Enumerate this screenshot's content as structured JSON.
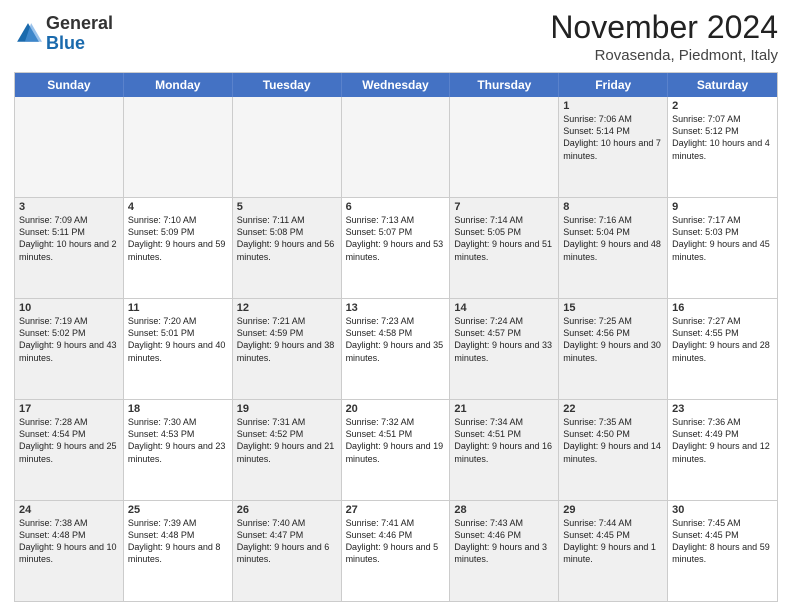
{
  "logo": {
    "general": "General",
    "blue": "Blue"
  },
  "header": {
    "month": "November 2024",
    "location": "Rovasenda, Piedmont, Italy"
  },
  "weekdays": [
    "Sunday",
    "Monday",
    "Tuesday",
    "Wednesday",
    "Thursday",
    "Friday",
    "Saturday"
  ],
  "rows": [
    [
      {
        "day": "",
        "text": "",
        "empty": true
      },
      {
        "day": "",
        "text": "",
        "empty": true
      },
      {
        "day": "",
        "text": "",
        "empty": true
      },
      {
        "day": "",
        "text": "",
        "empty": true
      },
      {
        "day": "",
        "text": "",
        "empty": true
      },
      {
        "day": "1",
        "text": "Sunrise: 7:06 AM\nSunset: 5:14 PM\nDaylight: 10 hours and 7 minutes.",
        "shaded": true
      },
      {
        "day": "2",
        "text": "Sunrise: 7:07 AM\nSunset: 5:12 PM\nDaylight: 10 hours and 4 minutes.",
        "shaded": false
      }
    ],
    [
      {
        "day": "3",
        "text": "Sunrise: 7:09 AM\nSunset: 5:11 PM\nDaylight: 10 hours and 2 minutes.",
        "shaded": true
      },
      {
        "day": "4",
        "text": "Sunrise: 7:10 AM\nSunset: 5:09 PM\nDaylight: 9 hours and 59 minutes.",
        "shaded": false
      },
      {
        "day": "5",
        "text": "Sunrise: 7:11 AM\nSunset: 5:08 PM\nDaylight: 9 hours and 56 minutes.",
        "shaded": true
      },
      {
        "day": "6",
        "text": "Sunrise: 7:13 AM\nSunset: 5:07 PM\nDaylight: 9 hours and 53 minutes.",
        "shaded": false
      },
      {
        "day": "7",
        "text": "Sunrise: 7:14 AM\nSunset: 5:05 PM\nDaylight: 9 hours and 51 minutes.",
        "shaded": true
      },
      {
        "day": "8",
        "text": "Sunrise: 7:16 AM\nSunset: 5:04 PM\nDaylight: 9 hours and 48 minutes.",
        "shaded": true
      },
      {
        "day": "9",
        "text": "Sunrise: 7:17 AM\nSunset: 5:03 PM\nDaylight: 9 hours and 45 minutes.",
        "shaded": false
      }
    ],
    [
      {
        "day": "10",
        "text": "Sunrise: 7:19 AM\nSunset: 5:02 PM\nDaylight: 9 hours and 43 minutes.",
        "shaded": true
      },
      {
        "day": "11",
        "text": "Sunrise: 7:20 AM\nSunset: 5:01 PM\nDaylight: 9 hours and 40 minutes.",
        "shaded": false
      },
      {
        "day": "12",
        "text": "Sunrise: 7:21 AM\nSunset: 4:59 PM\nDaylight: 9 hours and 38 minutes.",
        "shaded": true
      },
      {
        "day": "13",
        "text": "Sunrise: 7:23 AM\nSunset: 4:58 PM\nDaylight: 9 hours and 35 minutes.",
        "shaded": false
      },
      {
        "day": "14",
        "text": "Sunrise: 7:24 AM\nSunset: 4:57 PM\nDaylight: 9 hours and 33 minutes.",
        "shaded": true
      },
      {
        "day": "15",
        "text": "Sunrise: 7:25 AM\nSunset: 4:56 PM\nDaylight: 9 hours and 30 minutes.",
        "shaded": true
      },
      {
        "day": "16",
        "text": "Sunrise: 7:27 AM\nSunset: 4:55 PM\nDaylight: 9 hours and 28 minutes.",
        "shaded": false
      }
    ],
    [
      {
        "day": "17",
        "text": "Sunrise: 7:28 AM\nSunset: 4:54 PM\nDaylight: 9 hours and 25 minutes.",
        "shaded": true
      },
      {
        "day": "18",
        "text": "Sunrise: 7:30 AM\nSunset: 4:53 PM\nDaylight: 9 hours and 23 minutes.",
        "shaded": false
      },
      {
        "day": "19",
        "text": "Sunrise: 7:31 AM\nSunset: 4:52 PM\nDaylight: 9 hours and 21 minutes.",
        "shaded": true
      },
      {
        "day": "20",
        "text": "Sunrise: 7:32 AM\nSunset: 4:51 PM\nDaylight: 9 hours and 19 minutes.",
        "shaded": false
      },
      {
        "day": "21",
        "text": "Sunrise: 7:34 AM\nSunset: 4:51 PM\nDaylight: 9 hours and 16 minutes.",
        "shaded": true
      },
      {
        "day": "22",
        "text": "Sunrise: 7:35 AM\nSunset: 4:50 PM\nDaylight: 9 hours and 14 minutes.",
        "shaded": true
      },
      {
        "day": "23",
        "text": "Sunrise: 7:36 AM\nSunset: 4:49 PM\nDaylight: 9 hours and 12 minutes.",
        "shaded": false
      }
    ],
    [
      {
        "day": "24",
        "text": "Sunrise: 7:38 AM\nSunset: 4:48 PM\nDaylight: 9 hours and 10 minutes.",
        "shaded": true
      },
      {
        "day": "25",
        "text": "Sunrise: 7:39 AM\nSunset: 4:48 PM\nDaylight: 9 hours and 8 minutes.",
        "shaded": false
      },
      {
        "day": "26",
        "text": "Sunrise: 7:40 AM\nSunset: 4:47 PM\nDaylight: 9 hours and 6 minutes.",
        "shaded": true
      },
      {
        "day": "27",
        "text": "Sunrise: 7:41 AM\nSunset: 4:46 PM\nDaylight: 9 hours and 5 minutes.",
        "shaded": false
      },
      {
        "day": "28",
        "text": "Sunrise: 7:43 AM\nSunset: 4:46 PM\nDaylight: 9 hours and 3 minutes.",
        "shaded": true
      },
      {
        "day": "29",
        "text": "Sunrise: 7:44 AM\nSunset: 4:45 PM\nDaylight: 9 hours and 1 minute.",
        "shaded": true
      },
      {
        "day": "30",
        "text": "Sunrise: 7:45 AM\nSunset: 4:45 PM\nDaylight: 8 hours and 59 minutes.",
        "shaded": false
      }
    ]
  ]
}
